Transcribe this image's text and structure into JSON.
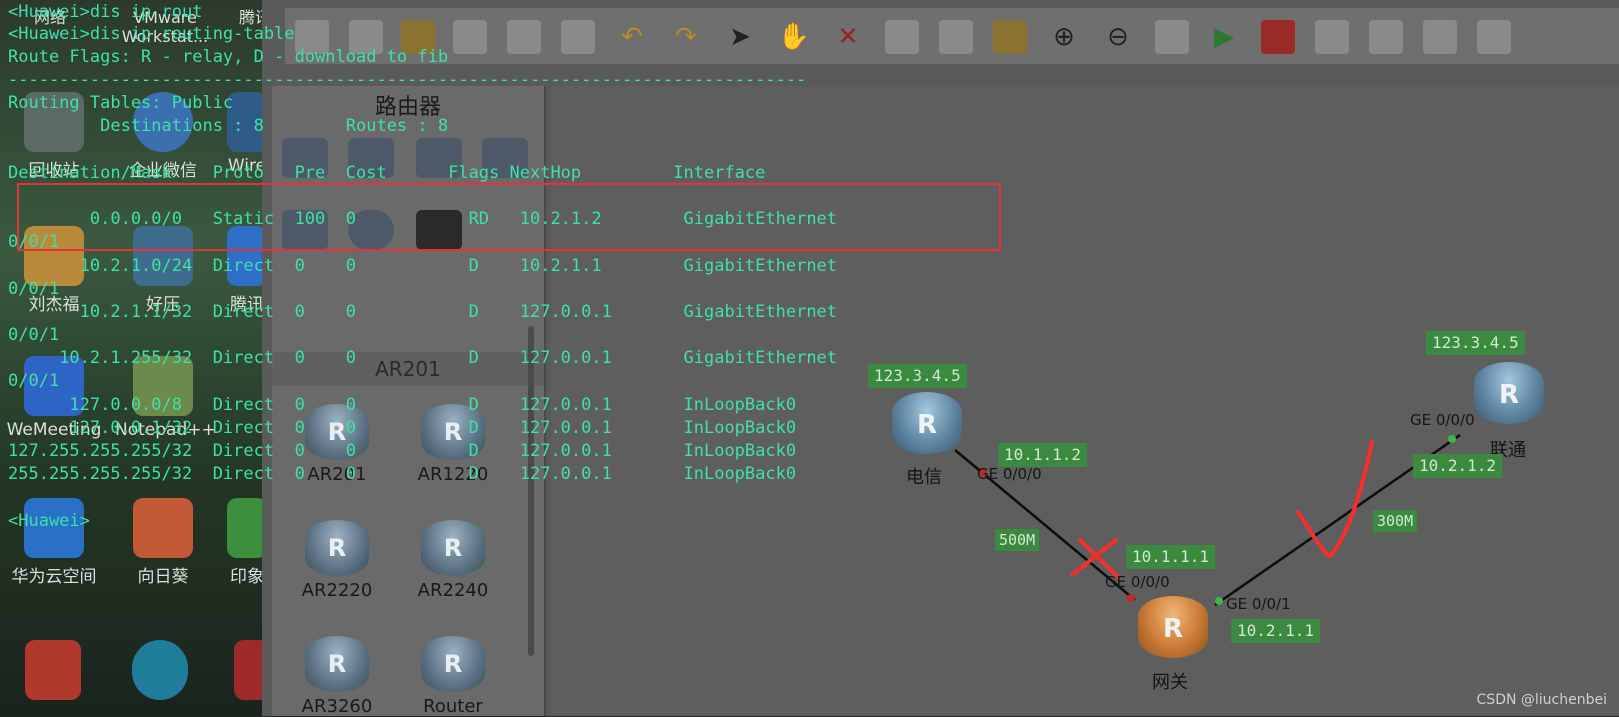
{
  "desktop": {
    "icons": [
      {
        "name": "recycle-bin",
        "label": "回收站"
      },
      {
        "name": "wechat-work",
        "label": "企业微信"
      },
      {
        "name": "wireshark",
        "label": "Wire"
      },
      {
        "name": "folder",
        "label": "刘杰福"
      },
      {
        "name": "haozip",
        "label": "好压"
      },
      {
        "name": "tencent",
        "label": "腾讯"
      },
      {
        "name": "wemeeting",
        "label": "WeMeeting"
      },
      {
        "name": "notepadpp",
        "label": "Notepad++"
      },
      {
        "name": "huawei-cloud",
        "label": "华为云空间"
      },
      {
        "name": "sunflower",
        "label": "向日葵"
      },
      {
        "name": "print",
        "label": "印象"
      },
      {
        "name": "vmware",
        "label": "VMware Workstat..."
      }
    ],
    "top_labels": [
      "网络",
      "VMware",
      "腾讯"
    ]
  },
  "terminal": {
    "lines": [
      "<Huawei>dis ip rout",
      "<Huawei>dis ip routing-table",
      "Route Flags: R - relay, D - download to fib",
      "------------------------------------------------------------------------------",
      "Routing Tables: Public",
      "         Destinations : 8        Routes : 8",
      "Destination/Mask    Proto   Pre  Cost      Flags NextHop         Interface",
      "        0.0.0.0/0   Static  100  0           RD   10.2.1.2        GigabitEthernet",
      "0/0/1",
      "       10.2.1.0/24  Direct  0    0           D    10.2.1.1        GigabitEthernet",
      "0/0/1",
      "       10.2.1.1/32  Direct  0    0           D    127.0.0.1       GigabitEthernet",
      "0/0/1",
      "     10.2.1.255/32  Direct  0    0           D    127.0.0.1       GigabitEthernet",
      "0/0/1",
      "      127.0.0.0/8   Direct  0    0           D    127.0.0.1       InLoopBack0",
      "      127.0.0.1/32  Direct  0    0           D    127.0.0.1       InLoopBack0",
      "127.255.255.255/32  Direct  0    0           D    127.0.0.1       InLoopBack0",
      "255.255.255.255/32  Direct  0    0           D    127.0.0.1       InLoopBack0",
      "<Huawei>"
    ]
  },
  "sidebar": {
    "title": "路由器",
    "subtitle": "AR201",
    "devices": [
      "AR201",
      "AR1220",
      "AR2220",
      "AR2240",
      "AR3260",
      "Router"
    ]
  },
  "topology": {
    "nodes": {
      "telecom": {
        "name": "电信",
        "ip": "123.3.4.5"
      },
      "unicom": {
        "name": "联通",
        "ip": "123.3.4.5"
      },
      "gateway": {
        "name": "网关"
      }
    },
    "ports": {
      "telecom_ge": "GE 0/0/0",
      "unicom_ge": "GE 0/0/0",
      "gateway_ge0": "GE 0/0/0",
      "gateway_ge1": "GE 0/0/1"
    },
    "ips": {
      "telecom_link": "10.1.1.2",
      "gateway_link_telecom": "10.1.1.1",
      "unicom_link": "10.2.1.2",
      "gateway_link_unicom": "10.2.1.1"
    },
    "bandwidth": {
      "left": "500M",
      "right": "300M"
    },
    "colors": {
      "link_label_bg": "#3b8a3f",
      "annotation_red": "#ff2b2b",
      "highlight_box": "#e0333a"
    }
  },
  "watermark": "CSDN @liuchenbei"
}
